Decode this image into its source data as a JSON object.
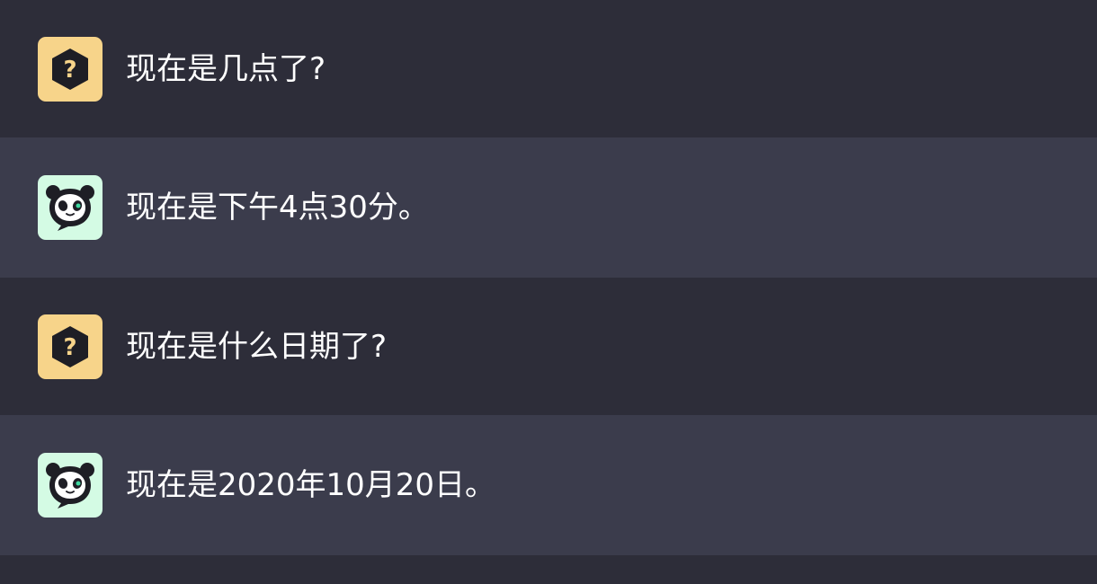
{
  "conversation": [
    {
      "role": "user",
      "avatar_icon": "question-hexagon-icon",
      "text": "现在是几点了?"
    },
    {
      "role": "bot",
      "avatar_icon": "panda-bubble-icon",
      "text": "现在是下午4点30分。"
    },
    {
      "role": "user",
      "avatar_icon": "question-hexagon-icon",
      "text": "现在是什么日期了?"
    },
    {
      "role": "bot",
      "avatar_icon": "panda-bubble-icon",
      "text": "现在是2020年10月20日。"
    }
  ],
  "colors": {
    "background": "#2d2d39",
    "bot_row": "#3b3c4c",
    "user_avatar": "#f7d48a",
    "bot_avatar": "#d4fbe4",
    "text": "#ffffff"
  }
}
